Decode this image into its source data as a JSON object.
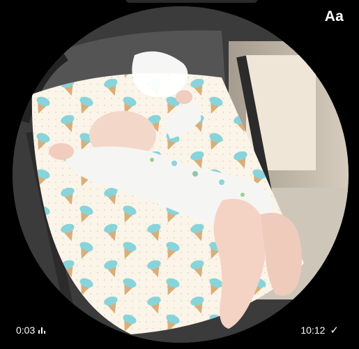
{
  "header": {
    "text_size_label": "Aa"
  },
  "video": {
    "duration": "0:03",
    "sent_time": "10:12",
    "duration_icon": "audio-wave-icon",
    "status_icon": "check-icon",
    "status_symbol": "✓"
  },
  "colors": {
    "background": "#000000",
    "text": "#ffffff"
  }
}
